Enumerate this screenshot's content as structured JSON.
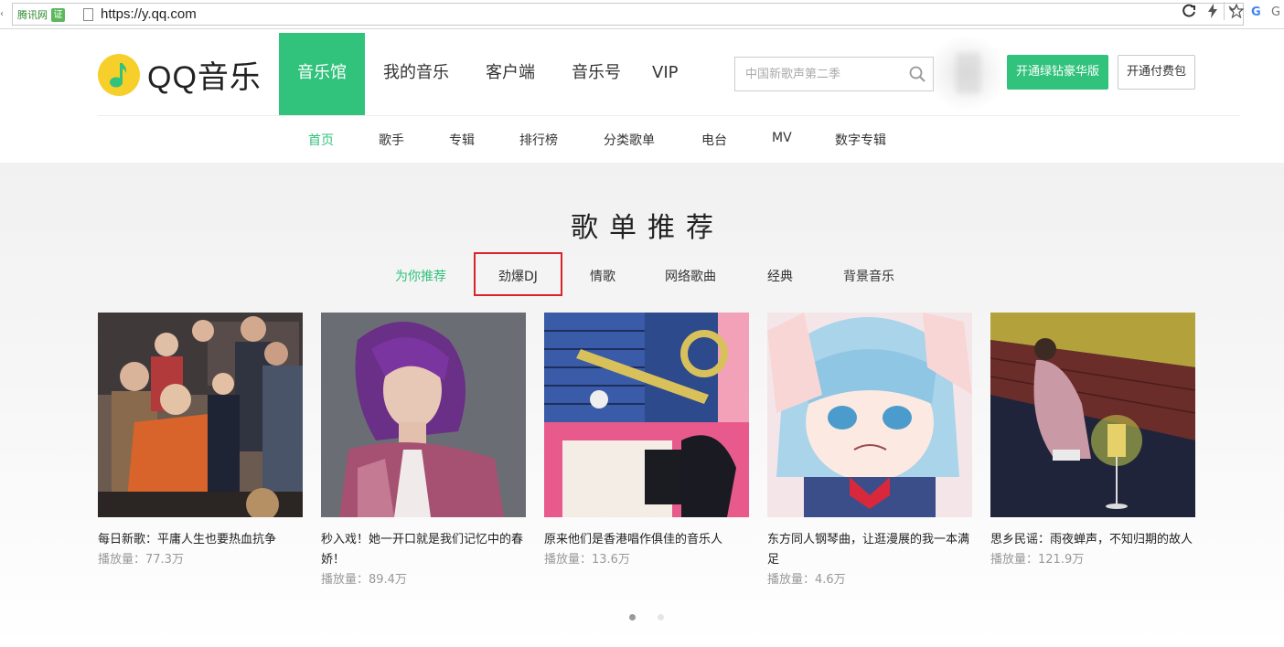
{
  "browser": {
    "edge_glyph": "‹",
    "cert_label": "腾讯网",
    "cert_badge": "证",
    "url": "https://y.qq.com",
    "search_engine_partial": "G",
    "search_engine_text": "G"
  },
  "header": {
    "logo_text": "QQ音乐",
    "nav": [
      {
        "label": "音乐馆",
        "active": true
      },
      {
        "label": "我的音乐"
      },
      {
        "label": "客户端"
      },
      {
        "label": "音乐号"
      },
      {
        "label": "VIP"
      }
    ],
    "search_placeholder": "中国新歌声第二季",
    "btn_green_label": "开通绿钻豪华版",
    "btn_outline_label": "开通付费包"
  },
  "subnav": [
    {
      "label": "首页",
      "active": true
    },
    {
      "label": "歌手"
    },
    {
      "label": "专辑"
    },
    {
      "label": "排行榜"
    },
    {
      "label": "分类歌单"
    },
    {
      "label": "电台"
    },
    {
      "label": "MV"
    },
    {
      "label": "数字专辑"
    }
  ],
  "section": {
    "title": "歌单推荐",
    "tabs": [
      {
        "label": "为你推荐",
        "active": true
      },
      {
        "label": "劲爆DJ",
        "highlighted": true
      },
      {
        "label": "情歌"
      },
      {
        "label": "网络歌曲"
      },
      {
        "label": "经典"
      },
      {
        "label": "背景音乐"
      }
    ],
    "cards": [
      {
        "title": "每日新歌：平庸人生也要热血抗争",
        "plays": "播放量：77.3万"
      },
      {
        "title": "秒入戏！她一开口就是我们记忆中的春娇！",
        "plays": "播放量：89.4万"
      },
      {
        "title": "原来他们是香港唱作俱佳的音乐人",
        "plays": "播放量：13.6万"
      },
      {
        "title": "东方同人钢琴曲，让逛漫展的我一本满足",
        "plays": "播放量：4.6万"
      },
      {
        "title": "思乡民谣：雨夜蝉声，不知归期的故人",
        "plays": "播放量：121.9万"
      }
    ],
    "pagination": {
      "current": 1,
      "total": 2
    }
  },
  "colors": {
    "accent": "#31c27c",
    "highlight_box": "#d9232a",
    "logo_yellow": "#f6cf2b"
  },
  "icons": {
    "refresh": "refresh-icon",
    "lightning": "lightning-icon",
    "star": "star-icon",
    "search": "search-icon"
  }
}
